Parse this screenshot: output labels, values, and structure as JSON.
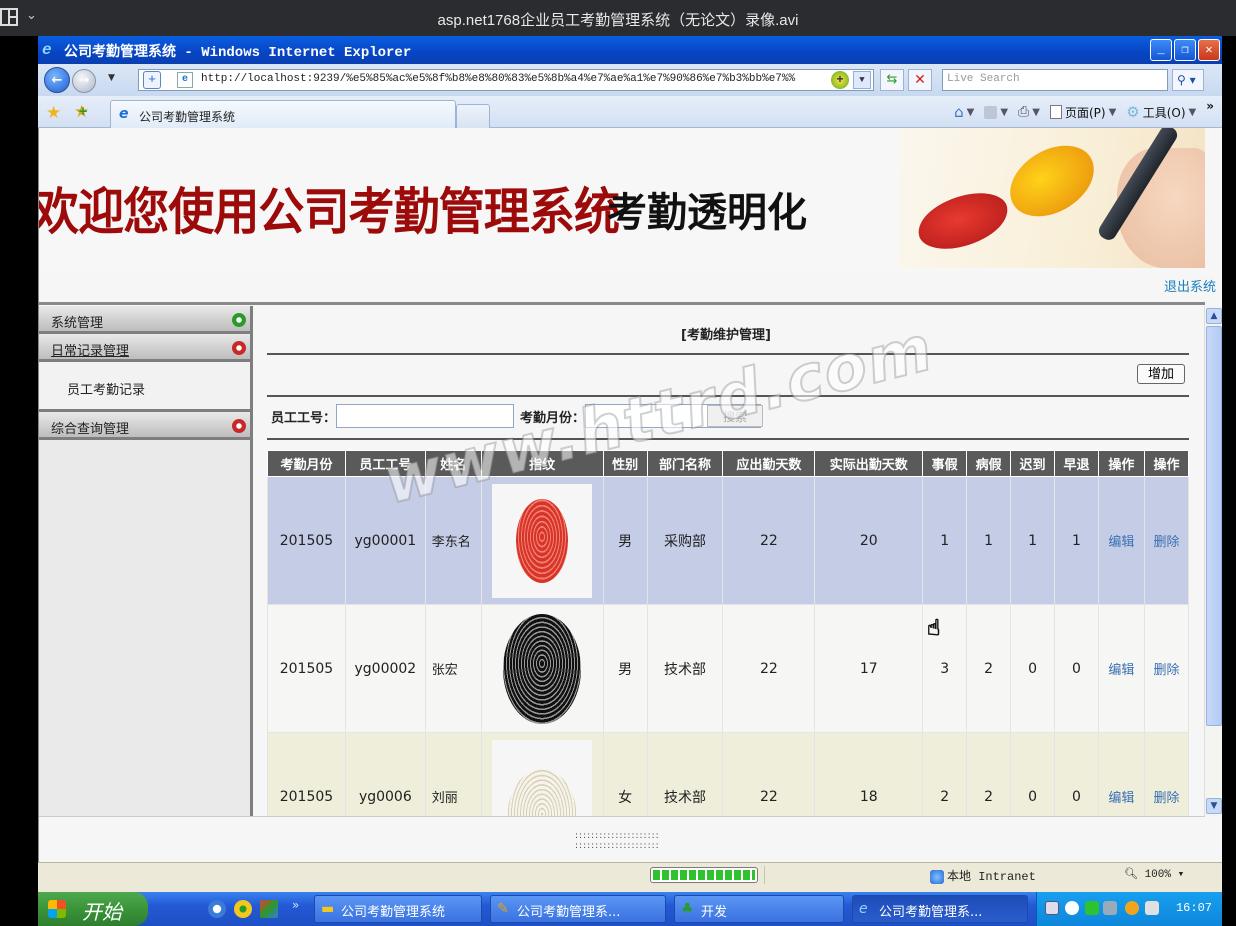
{
  "player": {
    "title": "asp.net1768企业员工考勤管理系统（无论文）录像.avi"
  },
  "window": {
    "title": "公司考勤管理系统 - Windows Internet Explorer",
    "controls": [
      "minimize",
      "restore",
      "close"
    ]
  },
  "address_bar": {
    "url": "http://localhost:9239/%e5%85%ac%e5%8f%b8%e8%80%83%e5%8b%a4%e7%ae%a1%e7%90%86%e7%b3%bb%e7%%",
    "search_placeholder": "Live Search"
  },
  "tab": {
    "label": "公司考勤管理系统"
  },
  "command_bar": {
    "page_label": "页面(P)",
    "tools_label": "工具(O)",
    "more": "»"
  },
  "banner": {
    "welcome": "欢迎您使用公司考勤管理系统",
    "slogan": "考勤透明化",
    "logout": "退出系统"
  },
  "sidebar": {
    "sections": [
      {
        "label": "系统管理",
        "icon": "expand-arrow-green-icon"
      },
      {
        "label": "日常记录管理",
        "icon": "collapse-arrow-red-icon",
        "items": [
          "员工考勤记录"
        ]
      },
      {
        "label": "综合查询管理",
        "icon": "collapse-arrow-red-icon"
      }
    ]
  },
  "main": {
    "section_title": "[考勤维护管理]",
    "add_button": "增加",
    "filter": {
      "employee_id_label": "员工工号：",
      "employee_id_value": "",
      "month_label": "考勤月份：",
      "month_value": "",
      "search_button": "搜索"
    },
    "table": {
      "columns": [
        "考勤月份",
        "员工工号",
        "姓名",
        "指纹",
        "性别",
        "部门名称",
        "应出勤天数",
        "实际出勤天数",
        "事假",
        "病假",
        "迟到",
        "早退",
        "操作",
        "操作"
      ],
      "rows": [
        {
          "month": "201505",
          "emp_id": "yg00001",
          "name": "李东名",
          "fingerprint": "red-fingerprint",
          "gender": "男",
          "dept": "采购部",
          "required_days": "22",
          "actual_days": "20",
          "personal_leave": "1",
          "sick_leave": "1",
          "late": "1",
          "early_leave": "1",
          "edit": "编辑",
          "delete": "删除"
        },
        {
          "month": "201505",
          "emp_id": "yg00002",
          "name": "张宏",
          "fingerprint": "black-fingerprint",
          "gender": "男",
          "dept": "技术部",
          "required_days": "22",
          "actual_days": "17",
          "personal_leave": "3",
          "sick_leave": "2",
          "late": "0",
          "early_leave": "0",
          "edit": "编辑",
          "delete": "删除"
        },
        {
          "month": "201505",
          "emp_id": "yg0006",
          "name": "刘丽",
          "fingerprint": "beige-fingerprint",
          "gender": "女",
          "dept": "技术部",
          "required_days": "22",
          "actual_days": "18",
          "personal_leave": "2",
          "sick_leave": "2",
          "late": "0",
          "early_leave": "0",
          "edit": "编辑",
          "delete": "删除"
        }
      ]
    },
    "watermark": "www.httrd.com"
  },
  "status_bar": {
    "progress_percent": 100,
    "zone": "本地 Intranet",
    "zoom": "100%"
  },
  "taskbar": {
    "start": "开始",
    "buttons": [
      {
        "label": "公司考勤管理系统",
        "icon": "folder-icon"
      },
      {
        "label": "公司考勤管理系...",
        "icon": "vs-icon"
      },
      {
        "label": "开发",
        "icon": "tree-icon"
      },
      {
        "label": "公司考勤管理系...",
        "icon": "ie-icon",
        "active": true
      }
    ],
    "clock": "16:07"
  }
}
